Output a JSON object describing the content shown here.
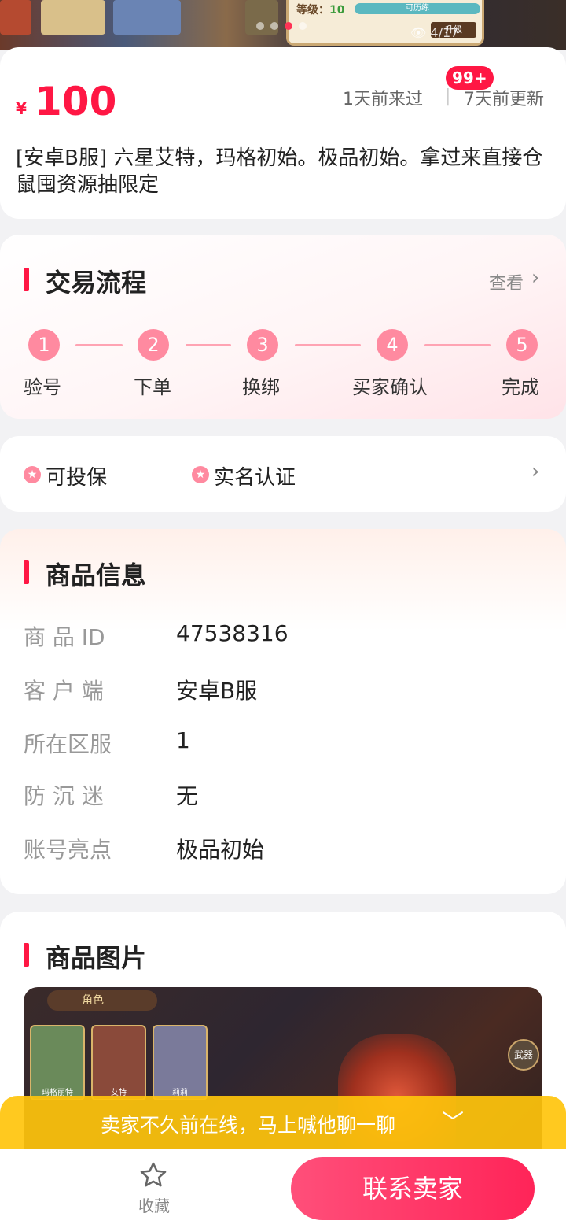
{
  "banner": {
    "level_label": "等级：",
    "level_value": "10",
    "level_bar_text": "可历练",
    "upgrade_label": "升级",
    "view_count": "4/17"
  },
  "listing": {
    "currency_symbol": "¥",
    "price": "100",
    "visited": "1天前来过",
    "separator": "|",
    "updated": "7天前更新",
    "badge": "99+",
    "description": "[安卓B服] 六星艾特，玛格初始。极品初始。拿过来直接仓鼠囤资源抽限定"
  },
  "trade_flow": {
    "title": "交易流程",
    "view_label": "查看",
    "steps": [
      {
        "num": "1",
        "label": "验号"
      },
      {
        "num": "2",
        "label": "下单"
      },
      {
        "num": "3",
        "label": "换绑"
      },
      {
        "num": "4",
        "label": "买家确认"
      },
      {
        "num": "5",
        "label": "完成"
      }
    ]
  },
  "guarantees": {
    "insurable": "可投保",
    "real_name": "实名认证"
  },
  "product_info": {
    "title": "商品信息",
    "rows": [
      {
        "key": "商 品 ID",
        "value": "47538316"
      },
      {
        "key": "客 户 端",
        "value": "安卓B服"
      },
      {
        "key": "所在区服",
        "value": "1"
      },
      {
        "key": "防 沉 迷",
        "value": "无"
      },
      {
        "key": "账号亮点",
        "value": "极品初始"
      }
    ]
  },
  "product_images": {
    "title": "商品图片",
    "game_tab": "角色",
    "characters": [
      "玛格丽特",
      "艾特",
      "莉莉"
    ],
    "weapon_label": "武器"
  },
  "notice": {
    "text": "卖家不久前在线，马上喊他聊一聊"
  },
  "bottom": {
    "favorite_label": "收藏",
    "contact_label": "联系卖家"
  },
  "colors": {
    "accent": "#ff1744",
    "step_pink": "#ff8aa0",
    "notice_yellow": "#ffc40c"
  }
}
